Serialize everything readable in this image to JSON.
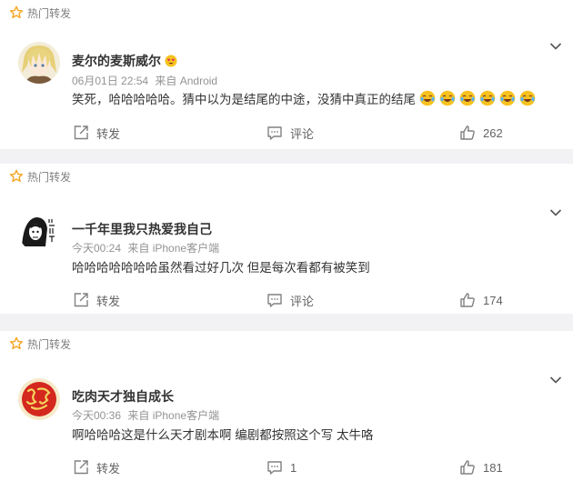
{
  "posts": [
    {
      "hot_label": "热门转发",
      "username": "麦尔的麦斯威尔",
      "date": "06月01日 22:54",
      "source": "来自 Android",
      "text": "笑死，哈哈哈哈哈。猜中以为是结尾的中途，没猜中真正的结尾",
      "repost_label": "转发",
      "comment_label": "评论",
      "like_count": "262"
    },
    {
      "hot_label": "热门转发",
      "username": "一千年里我只热爱我自己",
      "date": "今天00:24",
      "source": "来自 iPhone客户端",
      "text": "哈哈哈哈哈哈哈虽然看过好几次 但是每次看都有被笑到",
      "repost_label": "转发",
      "comment_label": "评论",
      "like_count": "174"
    },
    {
      "hot_label": "热门转发",
      "username": "吃肉天才独自成长",
      "date": "今天00:36",
      "source": "来自 iPhone客户端",
      "text": "啊哈哈哈这是什么天才剧本啊 编剧都按照这个写 太牛咯",
      "repost_label": "转发",
      "comment_label": "1",
      "like_count": "181"
    }
  ],
  "colors": {
    "hot_star": "#f5a623",
    "text_main": "#333333",
    "text_meta": "#939393",
    "action_gray": "#636363",
    "background": "#f2f2f5"
  },
  "icons": {
    "hot": "star-icon",
    "more": "chevron-down-icon",
    "repost": "repost-icon",
    "comment": "comment-icon",
    "like": "thumbs-up-icon",
    "emoji": "laugh-cry-emoji"
  }
}
